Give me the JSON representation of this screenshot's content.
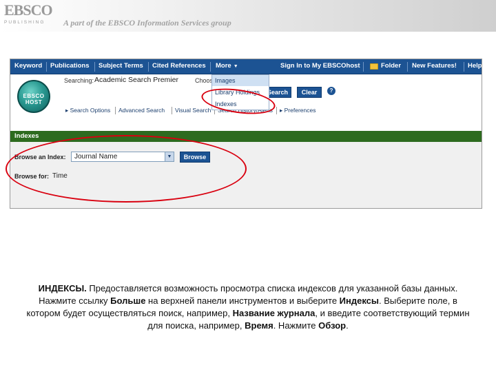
{
  "header": {
    "logo_text": "EBSCO",
    "logo_subtext": "PUBLISHING",
    "tagline": "A part of the EBSCO Information Services group"
  },
  "toolbar": {
    "keyword": "Keyword",
    "publications": "Publications",
    "subject_terms": "Subject Terms",
    "cited_references": "Cited References",
    "more": "More",
    "sign_in": "Sign In to My EBSCOhost",
    "folder": "Folder",
    "new_features": "New Features!",
    "help": "Help"
  },
  "more_menu": {
    "items": [
      "Images",
      "Library Holdings",
      "Indexes"
    ],
    "highlighted_index": 0
  },
  "search": {
    "badge_text": "EBSCO HOST",
    "searching_label": "Searching:",
    "database": "Academic Search Premier",
    "choose_text": "Choose",
    "search_button": "Search",
    "clear_button": "Clear",
    "help_icon": "?"
  },
  "options": {
    "search_options": "Search Options",
    "advanced_search": "Advanced Search",
    "visual_search": "Visual Search",
    "search_history": "Search History/Alerts",
    "preferences": "Preferences"
  },
  "indexes": {
    "section_title": "Indexes",
    "browse_index_label": "Browse an Index:",
    "index_value": "Journal Name",
    "browse_button": "Browse",
    "browse_for_label": "Browse for:",
    "browse_for_value": "Time"
  },
  "caption": {
    "lead": "ИНДЕКСЫ.",
    "t1": " Предоставляется возможность просмотра списка индексов для указанной базы данных. Нажмите ссылку ",
    "b1": "Больше",
    "t2": " на верхней панели инструментов и выберите ",
    "b2": "Индексы",
    "t3": ". Выберите поле, в котором будет осуществляться поиск, например, ",
    "b3": "Название журнала",
    "t4": ", и введите соответствующий термин для поиска, например, ",
    "b4": "Время",
    "t5": ". Нажмите ",
    "b5": "Обзор",
    "t6": "."
  },
  "colors": {
    "toolbar_blue": "#1c5393",
    "section_green": "#2d6b1f",
    "annotation_red": "#d9000f"
  }
}
